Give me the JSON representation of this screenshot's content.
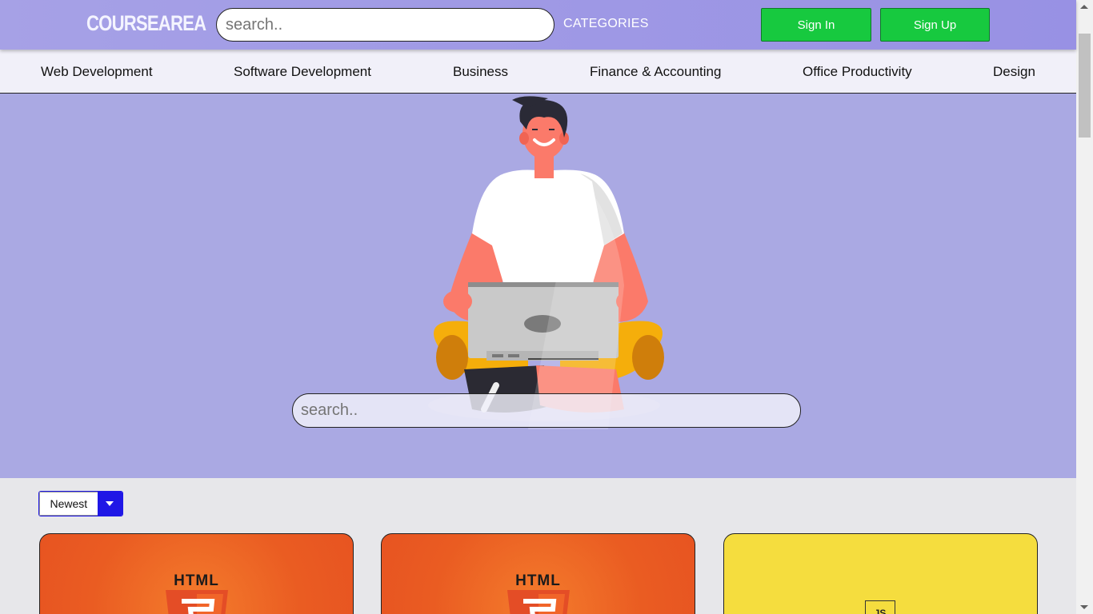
{
  "header": {
    "logo": "COURSEAREA",
    "search_placeholder": "search..",
    "categories_label": "CATEGORIES",
    "sign_in": "Sign In",
    "sign_up": "Sign Up"
  },
  "category_bar": {
    "items": [
      "Web Development",
      "Software Development",
      "Business",
      "Finance & Accounting",
      "Office Productivity",
      "Design"
    ]
  },
  "hero": {
    "illustration": "person-with-laptop-illustration",
    "search_placeholder": "search.."
  },
  "sort": {
    "selected": "Newest",
    "icon": "caret-down-icon"
  },
  "cards": [
    {
      "logo_text": "HTML",
      "icon": "html5-shield-icon"
    },
    {
      "logo_text": "HTML",
      "icon": "html5-shield-icon"
    },
    {
      "logo_text": "JS",
      "icon": "js-logo-icon"
    }
  ],
  "colors": {
    "navbar": "#9d97e5",
    "hero_bg": "#aaa9e3",
    "button_green": "#17c93f",
    "sort_accent": "#1f17e6",
    "html_orange": "#e9571f",
    "js_yellow": "#f5dd3e"
  }
}
